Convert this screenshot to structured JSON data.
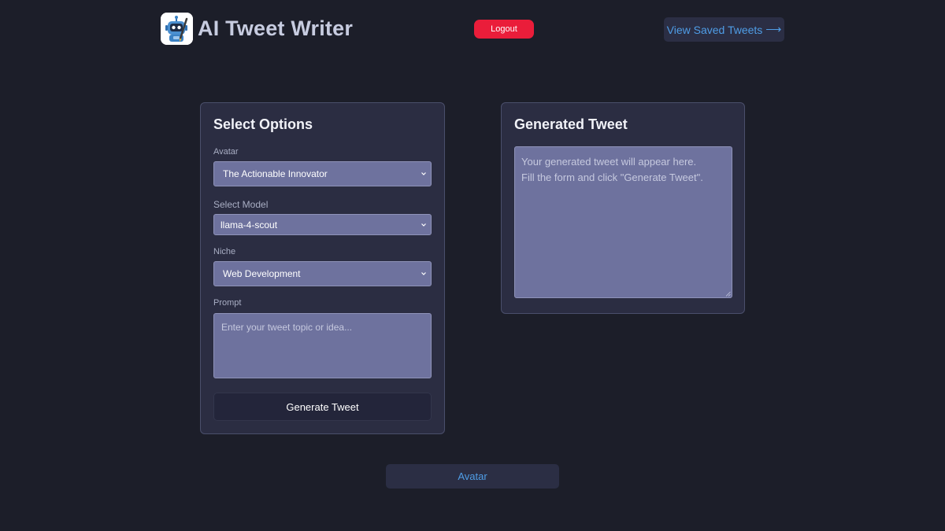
{
  "header": {
    "app_title": "AI Tweet Writer",
    "logo_icon": "robot-writer-icon",
    "logout_label": "Logout",
    "view_saved_label": "View Saved Tweets",
    "view_saved_arrow": "⟶"
  },
  "options": {
    "title": "Select Options",
    "avatar": {
      "label": "Avatar",
      "value": "The Actionable Innovator"
    },
    "model": {
      "label": "Select Model",
      "value": "llama-4-scout"
    },
    "niche": {
      "label": "Niche",
      "value": "Web Development"
    },
    "prompt": {
      "label": "Prompt",
      "placeholder": "Enter your tweet topic or idea..."
    },
    "generate_label": "Generate Tweet"
  },
  "output": {
    "title": "Generated Tweet",
    "line1": "Your generated tweet will appear here.",
    "line2": "Fill the form and click \"Generate Tweet\"."
  },
  "footer": {
    "avatar_button_label": "Avatar"
  },
  "colors": {
    "background": "#1c1e29",
    "card": "#2b2d42",
    "field": "#6e729e",
    "logout": "#ea1d3a",
    "link": "#4f9de6"
  }
}
